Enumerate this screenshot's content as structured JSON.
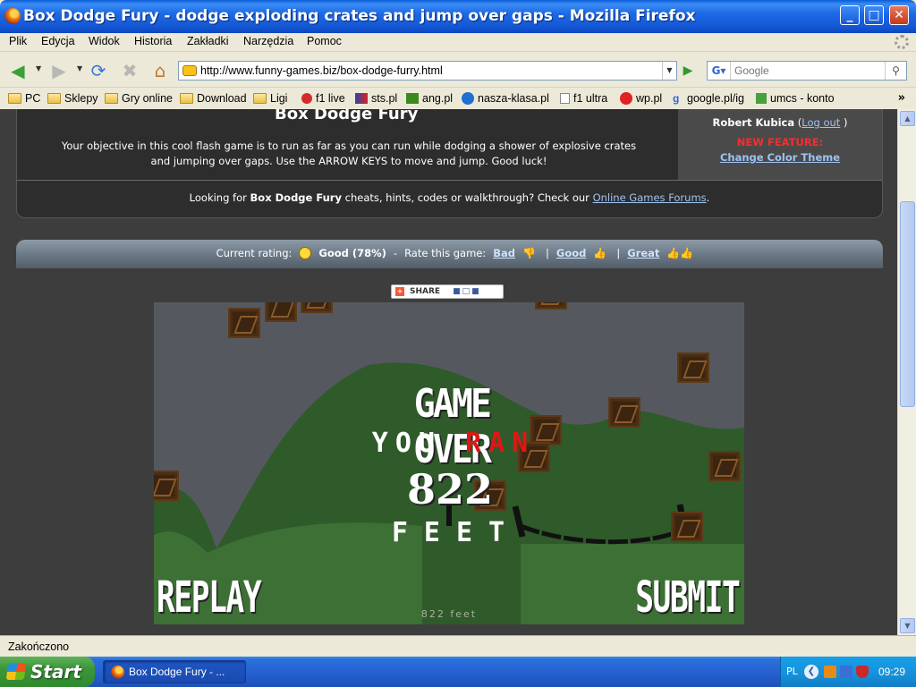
{
  "window": {
    "title": "Box Dodge Fury - dodge exploding crates and jump over gaps - Mozilla Firefox",
    "minimize": "_",
    "maximize": "□",
    "close": "✕"
  },
  "menu": {
    "items": [
      "Plik",
      "Edycja",
      "Widok",
      "Historia",
      "Zakładki",
      "Narzędzia",
      "Pomoc"
    ]
  },
  "navbar": {
    "url": "http://www.funny-games.biz/box-dodge-furry.html",
    "search_placeholder": "Google",
    "icons": [
      "back-icon",
      "forward-icon",
      "reload-icon",
      "stop-icon",
      "home-icon",
      "go-icon",
      "search-icon"
    ]
  },
  "bookmarks": {
    "items": [
      {
        "label": "PC",
        "icon": "folder-icon"
      },
      {
        "label": "Sklepy",
        "icon": "folder-icon"
      },
      {
        "label": "Gry online",
        "icon": "folder-icon"
      },
      {
        "label": "Download",
        "icon": "folder-icon"
      },
      {
        "label": "Ligi",
        "icon": "folder-icon"
      },
      {
        "label": "f1 live",
        "icon": "f1-icon"
      },
      {
        "label": "sts.pl",
        "icon": "sts-icon"
      },
      {
        "label": "ang.pl",
        "icon": "ang-icon"
      },
      {
        "label": "nasza-klasa.pl",
        "icon": "nk-icon"
      },
      {
        "label": "f1 ultra",
        "icon": "page-icon"
      },
      {
        "label": "wp.pl",
        "icon": "wp-icon"
      },
      {
        "label": "google.pl/ig",
        "icon": "google-icon"
      },
      {
        "label": "umcs - konto",
        "icon": "umcs-icon"
      }
    ],
    "more": "»"
  },
  "page": {
    "game_title": "Box Dodge Fury",
    "description": "Your objective in this cool flash game is to run as far as you can run while dodging a shower of explosive crates and jumping over gaps. Use the ARROW KEYS to move and jump. Good luck!",
    "cheats_prefix": "Looking for",
    "cheats_game": "Box Dodge Fury",
    "cheats_middle": "cheats, hints, codes or walkthrough? Check our",
    "cheats_link": "Online Games Forums",
    "cheats_end": ".",
    "user": {
      "name": "Robert Kubica",
      "open": "(",
      "logout": "Log out",
      "close": ")",
      "new_feature": "NEW FEATURE:",
      "change_theme": "Change Color Theme"
    },
    "rating": {
      "current_label": "Current rating:",
      "current_value": "Good (78%)",
      "dash": "-",
      "rate_label": "Rate this game:",
      "bad": "Bad",
      "good": "Good",
      "great": "Great",
      "sep": "|",
      "percent_good": 78
    },
    "share_label": "SHARE"
  },
  "game": {
    "game_over": "GAME OVER",
    "you": "YOU",
    "ran": "RAN",
    "score": "822",
    "feet": "FEET",
    "replay": "REPLAY",
    "submit": "SUBMIT",
    "hud": "822  feet"
  },
  "statusbar": {
    "text": "Zakończono"
  },
  "taskbar": {
    "start": "Start",
    "task_title": "Box Dodge Fury - ...",
    "lang": "PL",
    "time": "09:29"
  },
  "colors": {
    "xp_blue": "#1e6ae6",
    "page_bg": "#3d3d3d",
    "hill_green": "#2f5a2a",
    "link": "#9fc3f0",
    "alert_red": "#ff2a2a"
  }
}
